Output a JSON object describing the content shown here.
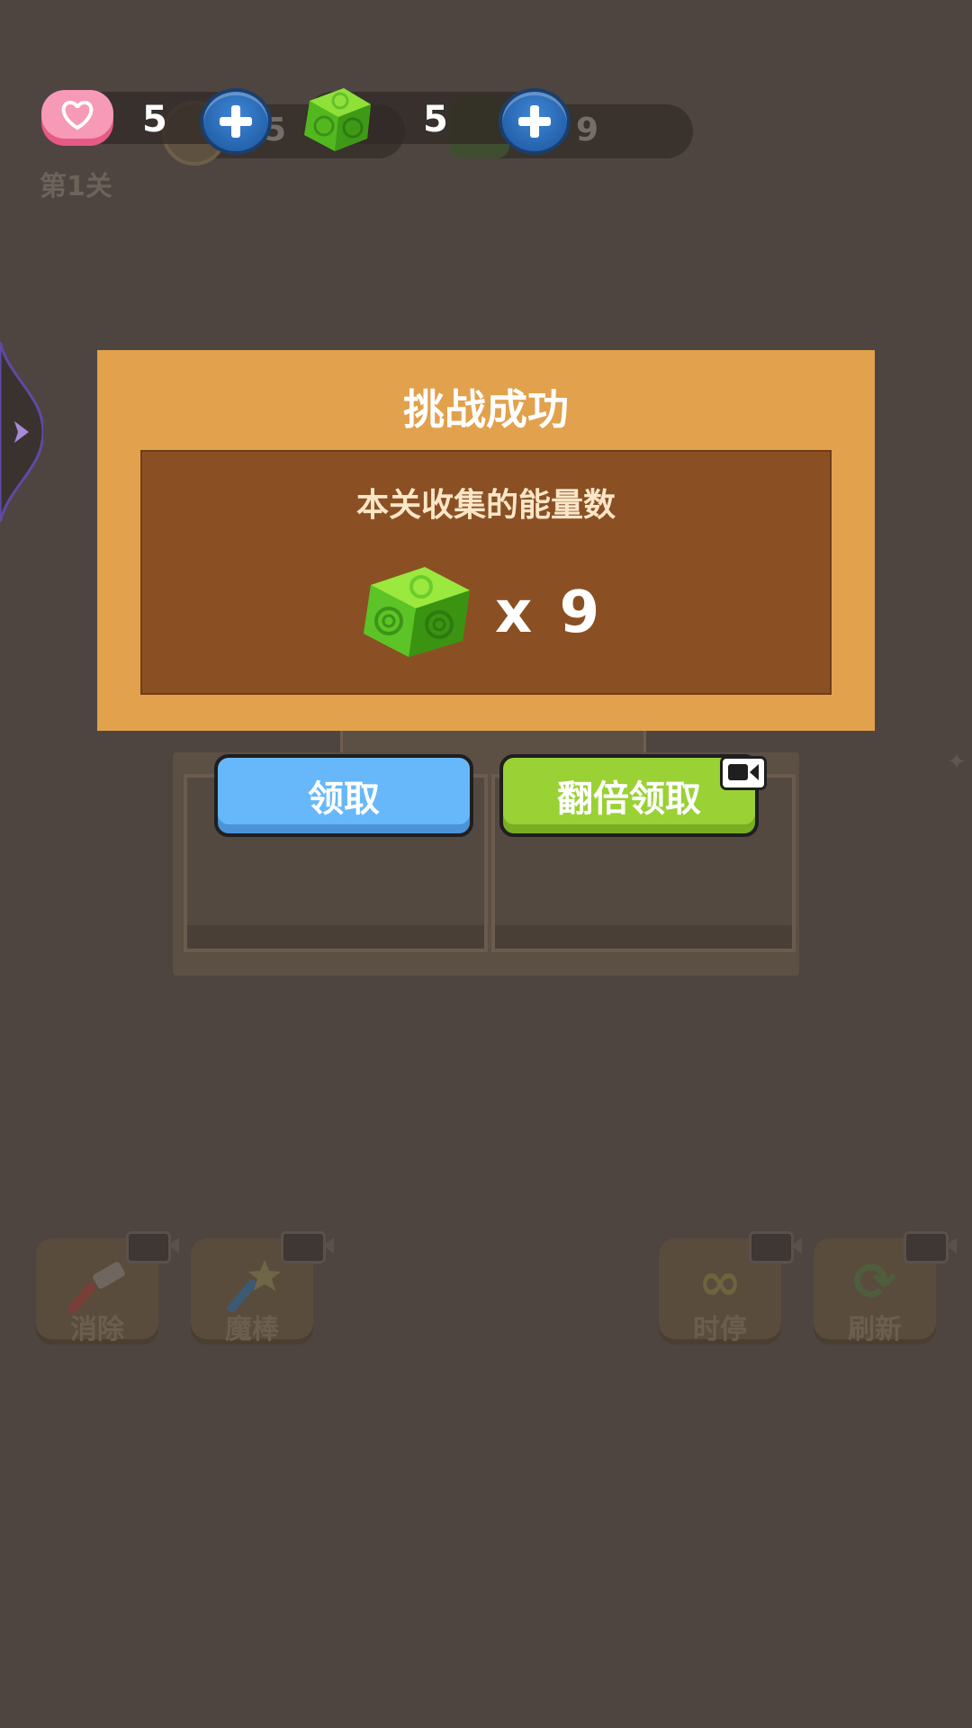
{
  "hud": {
    "lives": "5",
    "energy": "5",
    "bg_coins_partial": "05",
    "bg_energy_partial": "9",
    "level": "第1关"
  },
  "modal": {
    "title": "挑战成功",
    "caption": "本关收集的能量数",
    "reward_count": "x 9"
  },
  "buttons": {
    "claim": "领取",
    "double_claim": "翻倍领取"
  },
  "tools": [
    {
      "label": "消除",
      "icon": "hammer-icon"
    },
    {
      "label": "魔棒",
      "icon": "magic-wand-icon"
    },
    {
      "label": "时停",
      "icon": "infinity-icon"
    },
    {
      "label": "刷新",
      "icon": "refresh-icon"
    }
  ],
  "colors": {
    "modal_bg": "#e1a14d",
    "modal_inner": "#8a5024",
    "claim_button": "#66b8fa",
    "double_button": "#9ad135",
    "dim_overlay": "#4e4540"
  }
}
